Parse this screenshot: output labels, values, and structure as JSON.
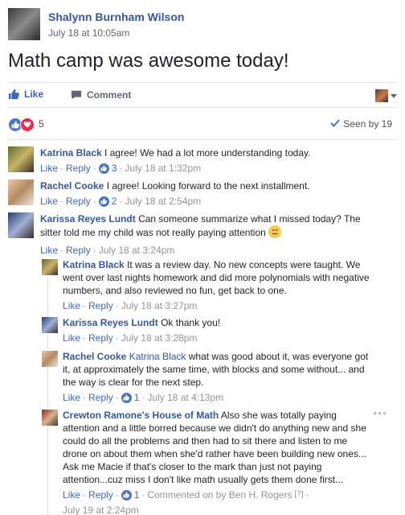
{
  "post": {
    "author": "Shalynn Burnham Wilson",
    "time": "July 18 at 10:05am",
    "text": "Math camp was awesome today!"
  },
  "actions": {
    "like_label": "Like",
    "comment_label": "Comment"
  },
  "reactions": {
    "count": "5",
    "seen_by": "Seen by 19"
  },
  "comments": [
    {
      "author": "Katrina Black",
      "text": "I agree! We had a lot more understanding today.",
      "like": "Like",
      "reply": "Reply",
      "likes": "3",
      "time": "July 18 at 1:32pm"
    },
    {
      "author": "Rachel Cooke",
      "text": "I agree! Looking forward to the next installment.",
      "like": "Like",
      "reply": "Reply",
      "likes": "2",
      "time": "July 18 at 2:54pm"
    },
    {
      "author": "Karissa Reyes Lundt",
      "text": "Can someone summarize what I missed today? The sitter told me my child was not really paying attention",
      "like": "Like",
      "reply": "Reply",
      "time": "July 18 at 3:24pm"
    }
  ],
  "replies": [
    {
      "author": "Katrina Black",
      "text": "It was a review day. No new concepts were taught. We went over last nights homework and did more polynomials with negative numbers, and also reviewed no fun, get back to one.",
      "like": "Like",
      "reply": "Reply",
      "time": "July 18 at 3:27pm"
    },
    {
      "author": "Karissa Reyes Lundt",
      "text": "Ok thank you!",
      "like": "Like",
      "reply": "Reply",
      "time": "July 18 at 3:28pm"
    },
    {
      "author": "Rachel Cooke",
      "mention": "Katrina Black",
      "text": "what was good about it, was everyone got it, at approximately the same time, with blocks and some without... and the way is clear for the next step.",
      "like": "Like",
      "reply": "Reply",
      "likes": "1",
      "time": "July 18 at 4:13pm"
    },
    {
      "author": "Crewton Ramone's House of Math",
      "text": "Also she was totally paying attention and a little borred because we didn't do anything new and she could do all the problems and then had to sit there and listen to me drone on about them when she'd rather have been building new ones... Ask me Macie if that's closer to the mark than just not paying attention...cuz miss I don't like math usually gets them done first...",
      "like": "Like",
      "reply": "Reply",
      "likes": "1",
      "commented_on": "Commented on by Ben H. Rogers",
      "edit_marker": "[?]",
      "time": "July 19 at 2:24pm"
    }
  ],
  "colors": {
    "link": "#365899",
    "action": "#4267b2",
    "meta": "#90949c",
    "like_reaction": "#4a76c4",
    "love_reaction": "#f0284a"
  },
  "icons": [
    "thumbs-up-icon",
    "comment-icon",
    "heart-icon",
    "checkmark-icon",
    "caret-down-icon",
    "smile-emoji-icon",
    "ellipsis-icon"
  ]
}
